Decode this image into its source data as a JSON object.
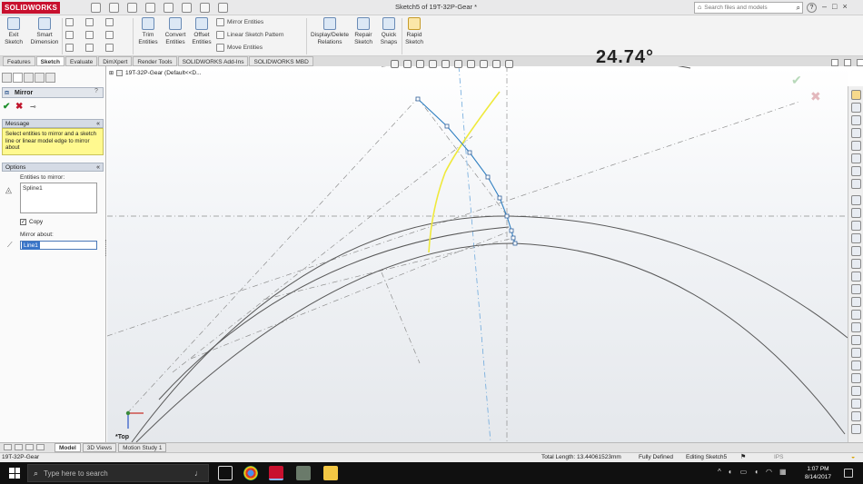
{
  "titlebar": {
    "app_name": "SOLIDWORKS",
    "document_title": "Sketch5 of 19T-32P-Gear *",
    "search_placeholder": "Search files and models",
    "help_label": "?"
  },
  "ribbon": {
    "exit_sketch": "Exit Sketch",
    "smart_dimension": "Smart Dimension",
    "trim_entities": "Trim Entities",
    "convert_entities": "Convert Entities",
    "offset_entities": "Offset Entities",
    "mirror_entities": "Mirror Entities",
    "linear_sketch_pattern": "Linear Sketch Pattern",
    "move_entities": "Move Entities",
    "display_delete_relations": "Display/Delete Relations",
    "repair_sketch": "Repair Sketch",
    "quick_snaps": "Quick Snaps",
    "rapid_sketch": "Rapid Sketch"
  },
  "tabs": [
    "Features",
    "Sketch",
    "Evaluate",
    "DimXpert",
    "Render Tools",
    "SOLIDWORKS Add-Ins",
    "SOLIDWORKS MBD"
  ],
  "active_tab": "Sketch",
  "property_manager": {
    "title": "Mirror",
    "help": "?",
    "message_header": "Message",
    "message_text": "Select entities to mirror and a sketch line or linear model edge to mirror about",
    "options_header": "Options",
    "entities_label": "Entities to mirror:",
    "entities_value": "Spline1",
    "copy_label": "Copy",
    "copy_checked": true,
    "mirror_about_label": "Mirror about:",
    "mirror_about_value": "Line1"
  },
  "graphics": {
    "tree_node": "19T-32P-Gear  (Default<<D...",
    "angle_text": "24.74°",
    "view_label": "*Top",
    "colors": {
      "sketch_entity": "#2f7fc1",
      "selected_spline": "#f2ec3a",
      "geometry": "#555555",
      "construction": "#8a8a8a"
    }
  },
  "bottom_tabs": [
    "Model",
    "3D Views",
    "Motion Study 1"
  ],
  "active_bottom_tab": "Model",
  "statusbar": {
    "doc": "19T-32P-Gear",
    "total_length": "Total Length: 13.44061523mm",
    "state": "Fully Defined",
    "editing": "Editing Sketch5",
    "units": "IPS"
  },
  "taskbar": {
    "search_placeholder": "Type here to search",
    "time": "1:07 PM",
    "date": "8/14/2017"
  }
}
